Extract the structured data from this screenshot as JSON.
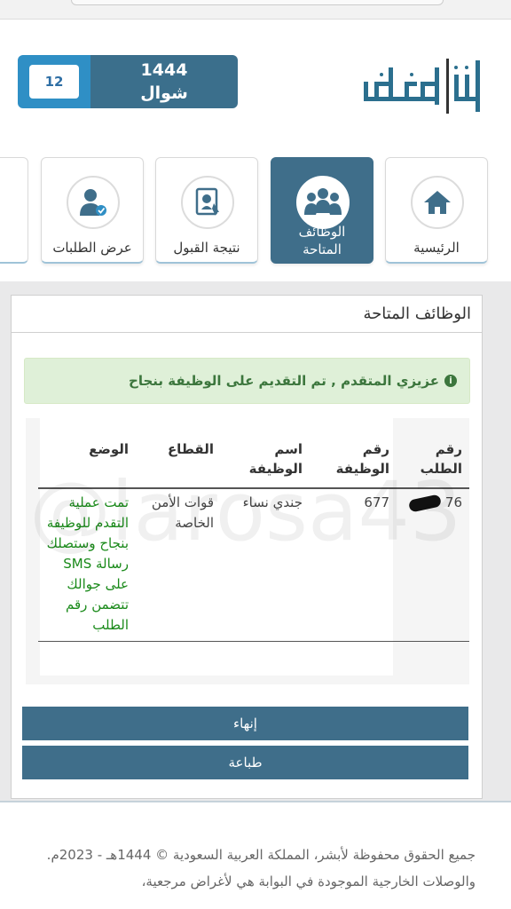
{
  "logo": {
    "text": "أبشر توظيف"
  },
  "date": {
    "day": "12",
    "year": "1444",
    "month": "شوال"
  },
  "nav": {
    "items": [
      {
        "label": "الرئيسية",
        "icon": "home-icon"
      },
      {
        "label": "الوظائف المتاحة",
        "icon": "group-icon",
        "active": true
      },
      {
        "label": "نتيجة القبول",
        "icon": "certificate-icon"
      },
      {
        "label": "عرض الطلبات",
        "icon": "user-check-icon"
      }
    ]
  },
  "panel": {
    "title": "الوظائف المتاحة",
    "alert": "عزيزي المتقدم , تم التقديم على الوظيفة بنجاح"
  },
  "watermark": "@larosa43",
  "table": {
    "headers": [
      "رقم الطلب",
      "رقم الوظيفة",
      "اسم الوظيفة",
      "القطاع",
      "الوضع"
    ],
    "rows": [
      {
        "request_no": "76",
        "job_no": "677",
        "job_name": "جندي نساء",
        "sector": "قوات الأمن الخاصة",
        "status": "تمت عملية التقدم للوظيفة بنجاح وستصلك رسالة SMS على جوالك تتضمن رقم الطلب"
      }
    ]
  },
  "buttons": {
    "finish": "إنهاء",
    "print": "طباعة"
  },
  "footer": {
    "text": "جميع الحقوق محفوظة لأبشر، المملكة العربية السعودية © 1444هـ - 2023م. والوصلات الخارجية الموجودة في البوابة هي لأغراض مرجعية،"
  },
  "colors": {
    "primary": "#3f6e8a",
    "accent": "#2f8fc5",
    "success_bg": "#dff0d8",
    "success_text": "#3c763d"
  }
}
